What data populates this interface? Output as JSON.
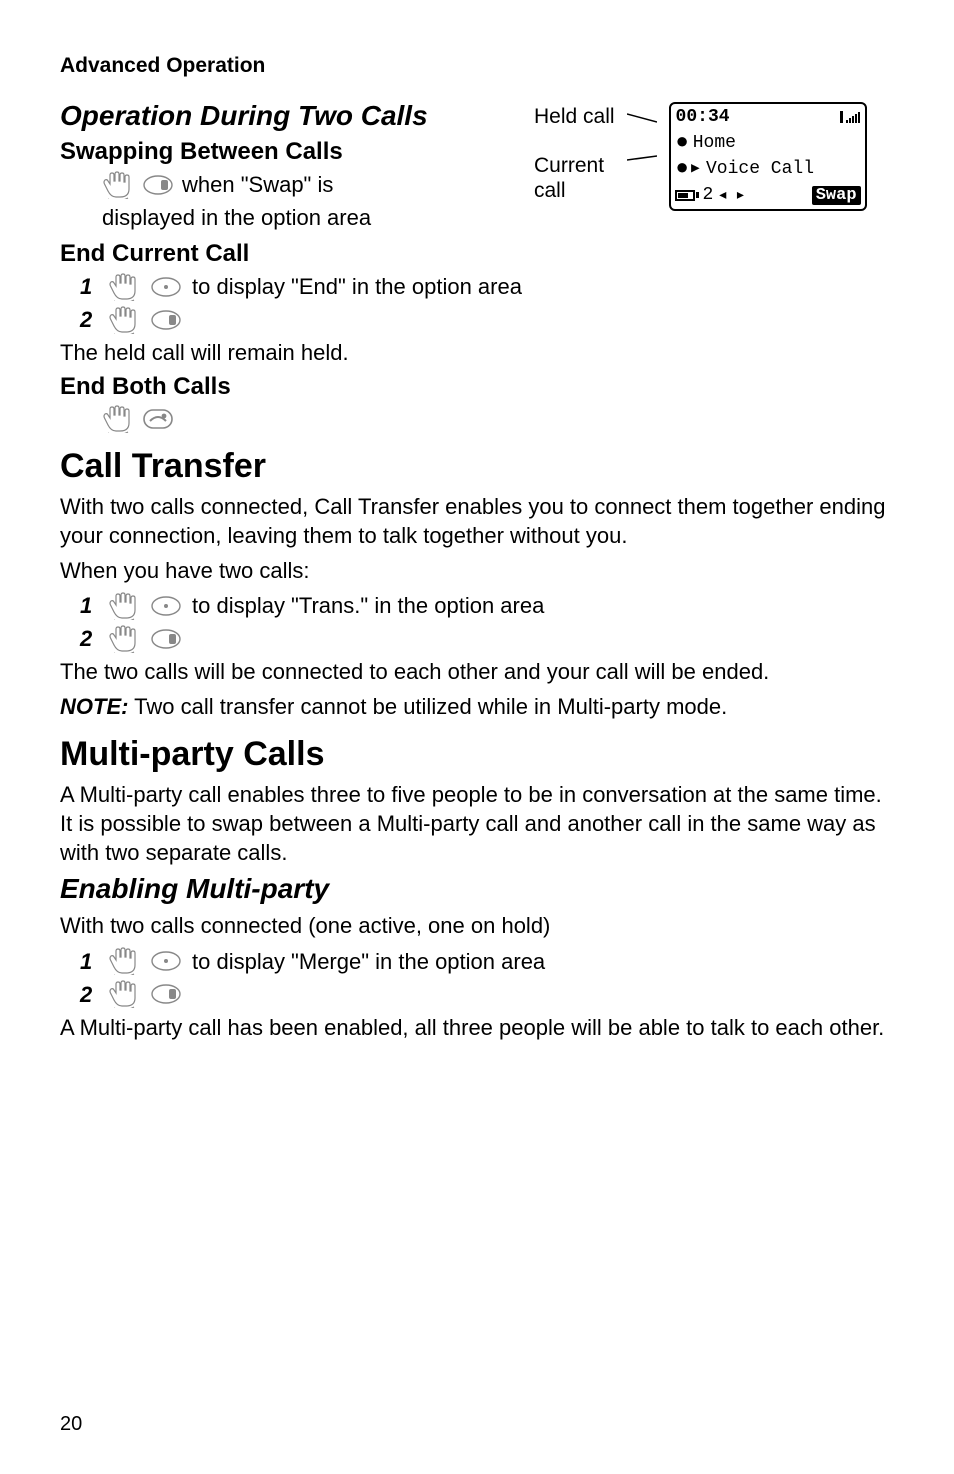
{
  "breadcrumb": "Advanced Operation",
  "section1": {
    "title": "Operation During Two Calls",
    "swap": {
      "heading": "Swapping Between Calls",
      "line1a": "when \"Swap\" is",
      "line2": "displayed in the option area"
    },
    "endCurrent": {
      "heading": "End Current Call",
      "step1": "to display \"End\" in the option area",
      "after": "The held call will remain held."
    },
    "endBoth": {
      "heading": "End Both Calls"
    }
  },
  "screen": {
    "heldLabel": "Held call",
    "currentLabel1": "Current",
    "currentLabel2": "call",
    "time": "00:34",
    "line1": "Home",
    "line2": "Voice Call",
    "botNum": "2",
    "swap": "Swap"
  },
  "callTransfer": {
    "title": "Call Transfer",
    "p1": "With two calls connected, Call Transfer enables you to connect them together ending your connection, leaving them to talk together without you.",
    "p2": "When you have two calls:",
    "step1": "to display \"Trans.\" in the option area",
    "p3": "The two calls will be connected to each other and your call will be ended.",
    "noteLabel": "NOTE:",
    "note": " Two call transfer cannot be utilized while in Multi-party mode."
  },
  "multiParty": {
    "title": "Multi-party Calls",
    "p1": "A Multi-party call enables three to five people to be in conversation at the same time. It is possible to swap between a Multi-party call and another call in the same way as with two separate calls.",
    "enableTitle": "Enabling Multi-party",
    "p2": "With two calls connected (one active, one on hold)",
    "step1": "to display \"Merge\" in the option area",
    "p3": "A Multi-party call has been enabled, all three people will be able to talk to each other."
  },
  "steps": {
    "n1": "1",
    "n2": "2"
  },
  "pageNumber": "20"
}
